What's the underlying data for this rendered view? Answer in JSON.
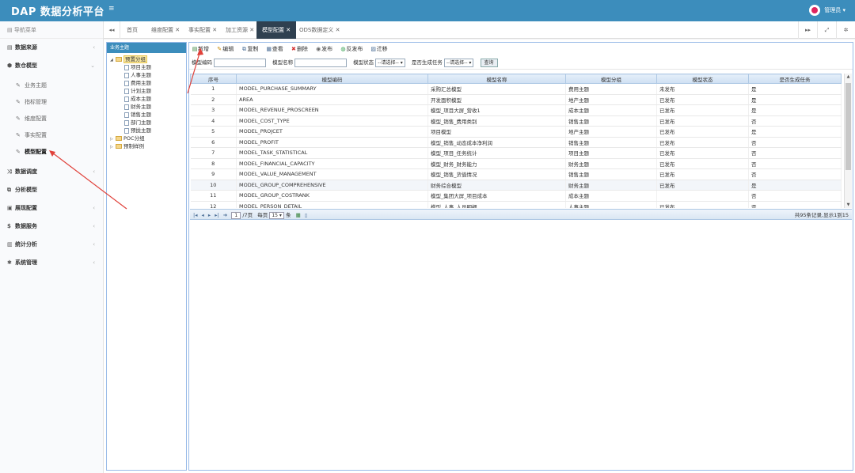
{
  "app": {
    "title": "DAP 数据分析平台",
    "menu_toggle": "≡"
  },
  "user": {
    "name": "管理员 ▾"
  },
  "sidebar": {
    "header": "导航菜单",
    "items": [
      {
        "label": "数据来源",
        "icon": "database-icon",
        "glyph": "▤",
        "chev": "‹"
      },
      {
        "label": "数仓模型",
        "icon": "cubes-icon",
        "glyph": "⬢",
        "chev": "⌄"
      },
      {
        "label": "数据调度",
        "icon": "random-icon",
        "glyph": "⤨",
        "chev": "‹"
      },
      {
        "label": "分析模型",
        "icon": "model-icon",
        "glyph": "⧉",
        "chev": ""
      },
      {
        "label": "展现配置",
        "icon": "display-icon",
        "glyph": "▣",
        "chev": "‹"
      },
      {
        "label": "数据服务",
        "icon": "dollar-icon",
        "glyph": "$",
        "chev": "‹"
      },
      {
        "label": "统计分析",
        "icon": "bar-chart-icon",
        "glyph": "▥",
        "chev": "‹"
      },
      {
        "label": "系统管理",
        "icon": "gear-icon",
        "glyph": "✱",
        "chev": "‹"
      }
    ],
    "subitems": [
      {
        "label": "业务主题"
      },
      {
        "label": "指标管理"
      },
      {
        "label": "维度配置"
      },
      {
        "label": "事实配置"
      },
      {
        "label": "模型配置"
      }
    ]
  },
  "tabs": {
    "nav_left": "◂◂",
    "items": [
      "首页",
      "维度配置 ✕",
      "事实配置 ✕",
      "加工资源 ✕",
      "模型配置 ✕",
      "ODS数据定义 ✕"
    ],
    "right": [
      "▸▸",
      "⤢",
      "✲"
    ]
  },
  "tree": {
    "header": "业务主题",
    "root": "预置分组",
    "children": [
      "项目主题",
      "人事主题",
      "费用主题",
      "计划主题",
      "成本主题",
      "财务主题",
      "销售主题",
      "部门主题",
      "预拢主题"
    ],
    "others": [
      "POC分组",
      "预制样例"
    ]
  },
  "toolbar": [
    {
      "label": "新增",
      "glyph": "▤",
      "color": "#2e7d32"
    },
    {
      "label": "编辑",
      "glyph": "✎",
      "color": "#c98a00"
    },
    {
      "label": "复制",
      "glyph": "⧉",
      "color": "#4a6d95"
    },
    {
      "label": "查看",
      "glyph": "▦",
      "color": "#4a6d95"
    },
    {
      "label": "删除",
      "glyph": "✖",
      "color": "#d32f2f"
    },
    {
      "label": "发布",
      "glyph": "◉",
      "color": "#666"
    },
    {
      "label": "反发布",
      "glyph": "◍",
      "color": "#2e9c4a"
    },
    {
      "label": "迁移",
      "glyph": "▨",
      "color": "#4a6d95"
    }
  ],
  "search": {
    "code_label": "模型编码",
    "name_label": "模型名称",
    "status_label": "模型状态",
    "status_value": "--请选择-- ▾",
    "task_label": "是否生成任务",
    "task_value": "--请选择-- ▾",
    "button": "查询"
  },
  "table": {
    "columns": [
      "序号",
      "模型编码",
      "模型名称",
      "模型分组",
      "模型状态",
      "是否生成任务"
    ],
    "rows": [
      [
        "1",
        "MODEL_PURCHASE_SUMMARY",
        "采购汇总模型",
        "费用主题",
        "未发布",
        "是"
      ],
      [
        "2",
        "AREA",
        "开发面积模型",
        "地产主题",
        "已发布",
        "是"
      ],
      [
        "3",
        "MODEL_REVENUE_PROSCREEN",
        "模型_项目大屏_营收1",
        "成本主题",
        "已发布",
        "是"
      ],
      [
        "4",
        "MODEL_COST_TYPE",
        "模型_销售_费用类别",
        "销售主题",
        "已发布",
        "否"
      ],
      [
        "5",
        "MODEL_PROJCET",
        "项目模型",
        "地产主题",
        "已发布",
        "是"
      ],
      [
        "6",
        "MODEL_PROFIT",
        "模型_销售_动态成本净利润",
        "销售主题",
        "已发布",
        "否"
      ],
      [
        "7",
        "MODEL_TASK_STATISTICAL",
        "模型_项目_任务统计",
        "项目主题",
        "已发布",
        "否"
      ],
      [
        "8",
        "MODEL_FINANCIAL_CAPACITY",
        "模型_财务_财务能力",
        "财务主题",
        "已发布",
        "否"
      ],
      [
        "9",
        "MODEL_VALUE_MANAGEMENT",
        "模型_销售_货值情况",
        "销售主题",
        "已发布",
        "否"
      ],
      [
        "10",
        "MODEL_GROUP_COMPREHENSIVE",
        "财务综合模型",
        "财务主题",
        "已发布",
        "是"
      ],
      [
        "11",
        "MODEL_GROUP_COSTRANK",
        "模型_集团大屏_项目成本",
        "成本主题",
        "",
        "否"
      ],
      [
        "12",
        "MODEL_PERSON_DETAIL",
        "模型_人事_人员明细",
        "人事主题",
        "已发布",
        "否"
      ]
    ]
  },
  "pager": {
    "first": "|◂",
    "prev": "◂",
    "next": "▸",
    "last": "▸|",
    "goto_icon": "➜",
    "page_value": "1",
    "page_total": "/7页",
    "per_page_label": "每页",
    "per_page_value": "15 ▾",
    "per_page_unit": "条",
    "info": "共95条记录,显示1到15"
  },
  "colors": {
    "header": "#3c8dbc",
    "active_tab": "#2f4050",
    "annotation": "#e0413a"
  }
}
